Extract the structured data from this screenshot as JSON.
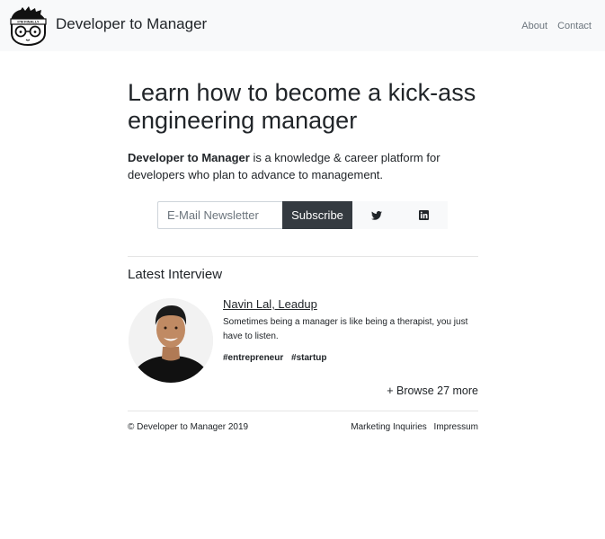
{
  "header": {
    "brand": "Developer to Manager",
    "logo_text": "ll'M FINALLY",
    "nav": [
      {
        "label": "About"
      },
      {
        "label": "Contact"
      }
    ]
  },
  "hero": {
    "headline": "Learn how to become a kick-ass engineering manager",
    "intro_bold": "Developer to Manager",
    "intro_rest": " is a knowledge & career platform for developers who plan to advance to management."
  },
  "newsletter": {
    "placeholder": "E-Mail Newsletter",
    "subscribe_label": "Subscribe",
    "icons": [
      "twitter-icon",
      "linkedin-icon"
    ]
  },
  "latest": {
    "title": "Latest Interview",
    "name": "Navin Lal, Leadup",
    "quote": "Sometimes being a manager is like being a therapist, you just have to listen.",
    "tags": [
      "#entrepreneur",
      "#startup"
    ],
    "browse": "+ Browse 27 more"
  },
  "footer": {
    "copyright": "© Developer to Manager 2019",
    "links": [
      {
        "label": "Marketing Inquiries"
      },
      {
        "label": "Impressum"
      }
    ]
  },
  "colors": {
    "navbar_bg": "#f8f9fa",
    "button_dark": "#343a40",
    "text": "#212529",
    "muted": "#6c757d"
  }
}
